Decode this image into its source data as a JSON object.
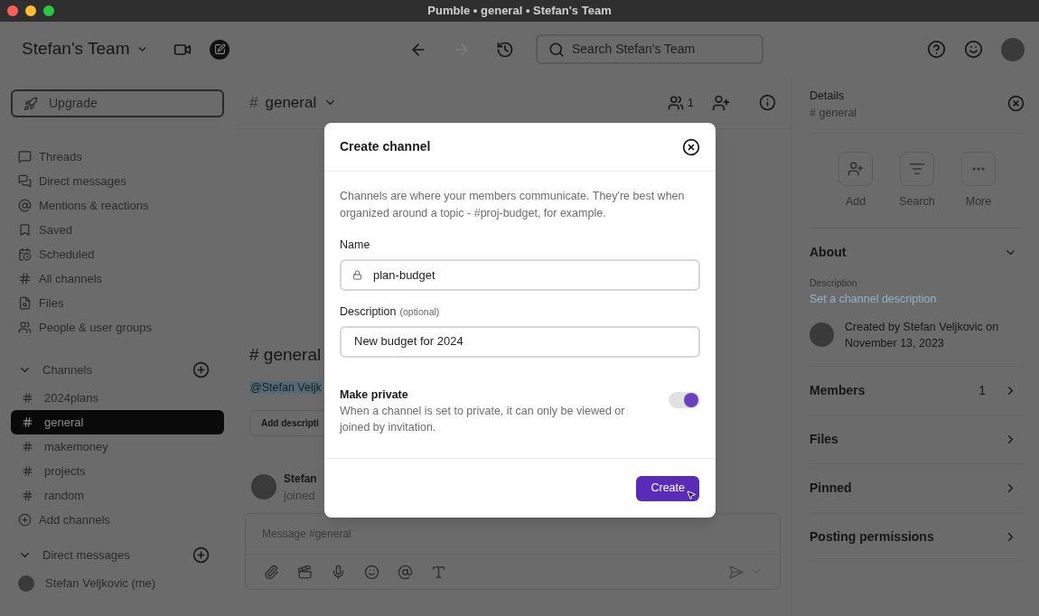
{
  "window": {
    "title": "Pumble • general • Stefan's Team"
  },
  "team": {
    "name": "Stefan's Team"
  },
  "search": {
    "placeholder": "Search Stefan's Team"
  },
  "sidebar": {
    "upgrade": "Upgrade",
    "nav": [
      {
        "label": "Threads"
      },
      {
        "label": "Direct messages"
      },
      {
        "label": "Mentions & reactions"
      },
      {
        "label": "Saved"
      },
      {
        "label": "Scheduled"
      },
      {
        "label": "All channels"
      },
      {
        "label": "Files"
      },
      {
        "label": "People & user groups"
      }
    ],
    "channels": {
      "title": "Channels",
      "expanded": true,
      "items": [
        {
          "label": "2024plans",
          "selected": false
        },
        {
          "label": "general",
          "selected": true
        },
        {
          "label": "makemoney",
          "selected": false
        },
        {
          "label": "projects",
          "selected": false
        },
        {
          "label": "random",
          "selected": false
        }
      ],
      "add_label": "Add channels"
    },
    "direct_messages": {
      "title": "Direct messages",
      "expanded": true,
      "items": [
        {
          "label": "Stefan Veljkovic (me)"
        }
      ]
    }
  },
  "channel_header": {
    "prefix": "#",
    "name": "general",
    "member_count": "1"
  },
  "intro": {
    "heading": "# general",
    "mention": "@Stefan Veljk",
    "button": "Add descripti"
  },
  "message": {
    "author": "Stefan",
    "text": "joined"
  },
  "composer": {
    "placeholder": "Message #general"
  },
  "modal": {
    "title": "Create channel",
    "intro": "Channels are where your members communicate. They're best when organized around a topic - #proj-budget, for example.",
    "name_label": "Name",
    "name_value": "plan-budget",
    "desc_label": "Description",
    "desc_hint": "(optional)",
    "desc_value": "New budget for 2024",
    "private_title": "Make private",
    "private_text": "When a channel is set to private, it can only be viewed or joined by invitation.",
    "private_on": true,
    "create": "Create"
  },
  "details": {
    "title": "Details",
    "channel": "# general",
    "actions": [
      {
        "label": "Add"
      },
      {
        "label": "Search"
      },
      {
        "label": "More"
      }
    ],
    "about": {
      "title": "About",
      "expanded": true,
      "desc_label": "Description",
      "desc_link": "Set a channel description",
      "created": "Created by Stefan Veljkovic on November 13, 2023"
    },
    "sections": [
      {
        "label": "Members",
        "count": "1"
      },
      {
        "label": "Files"
      },
      {
        "label": "Pinned"
      },
      {
        "label": "Posting permissions"
      }
    ]
  }
}
